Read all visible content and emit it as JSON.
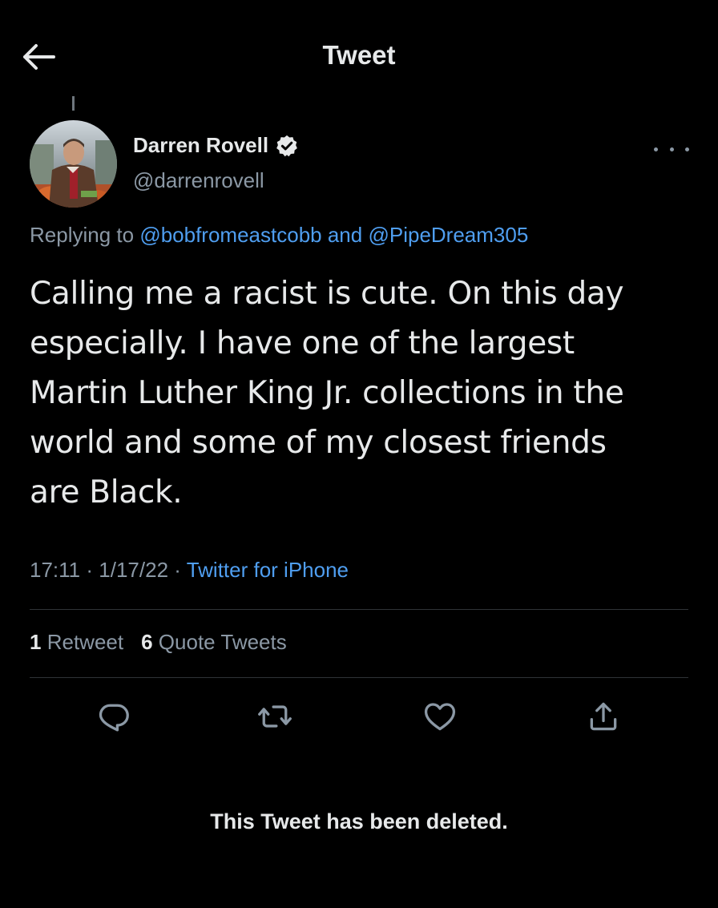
{
  "header": {
    "title": "Tweet",
    "back_icon": "arrow-left-icon"
  },
  "author": {
    "name": "Darren Rovell",
    "handle": "@darrenrovell",
    "verified_icon": "verified-badge-icon",
    "more_icon": "more-horizontal-icon"
  },
  "replying": {
    "prefix": "Replying to",
    "user1": "@bobfromeastcobb",
    "joiner": "and",
    "user2": "@PipeDream305"
  },
  "tweet": {
    "lines": [
      "Calling me a racist is cute. On this day",
      "especially. I have one of the largest",
      "Martin Luther King Jr. collections in the",
      "world and some of my closest friends",
      "are Black."
    ]
  },
  "meta": {
    "time": "17:11",
    "sep1": "·",
    "date": "1/17/22",
    "sep2": "·",
    "source": "Twitter for iPhone"
  },
  "stats": {
    "retweets_count": "1",
    "retweets_label": "Retweet",
    "quotes_count": "6",
    "quotes_label": "Quote Tweets"
  },
  "actions": {
    "reply_icon": "reply-icon",
    "retweet_icon": "retweet-icon",
    "like_icon": "heart-icon",
    "share_icon": "share-icon"
  },
  "notice": "This Tweet has been deleted.",
  "colors": {
    "background": "#000000",
    "text": "#e7e9ea",
    "secondary": "#8b98a5",
    "link": "#4f9ef0",
    "divider": "#2f3336"
  }
}
